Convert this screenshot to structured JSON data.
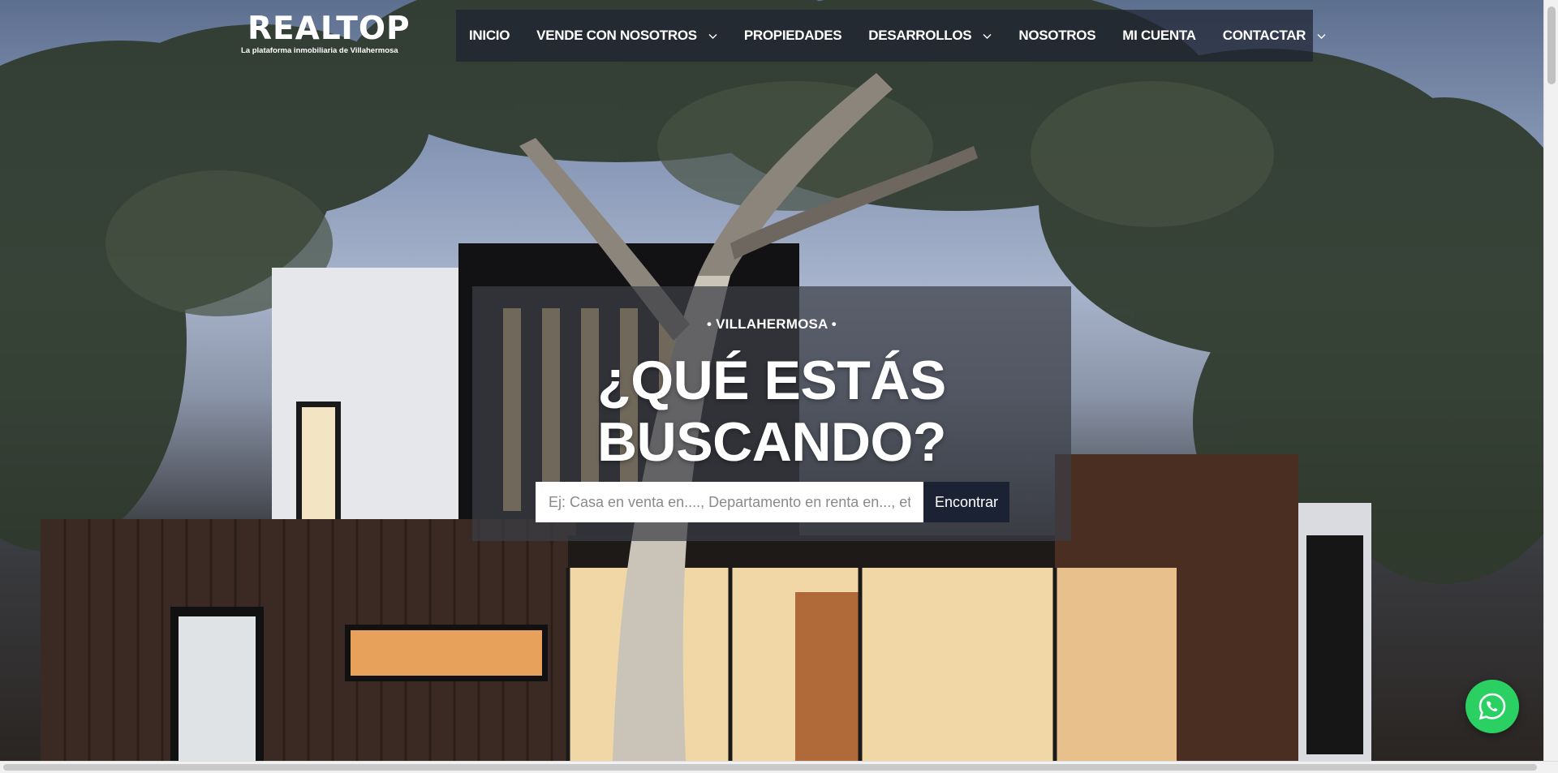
{
  "brand": {
    "logo_text": "REALTOP",
    "tagline": "La plataforma inmobiliaria de Villahermosa"
  },
  "nav": {
    "items": [
      {
        "label": "INICIO",
        "has_dropdown": false
      },
      {
        "label": "VENDE CON NOSOTROS",
        "has_dropdown": true
      },
      {
        "label": "PROPIEDADES",
        "has_dropdown": false
      },
      {
        "label": "DESARROLLOS",
        "has_dropdown": true
      },
      {
        "label": "NOSOTROS",
        "has_dropdown": false
      },
      {
        "label": "MI CUENTA",
        "has_dropdown": false
      },
      {
        "label": "CONTACTAR",
        "has_dropdown": true
      }
    ]
  },
  "hero": {
    "kicker": "• VILLAHERMOSA •",
    "headline": "¿QUÉ ESTÁS BUSCANDO?"
  },
  "search": {
    "placeholder": "Ej: Casa en venta en...., Departamento en renta en..., etc",
    "value": "",
    "button_label": "Encontrar"
  },
  "floating": {
    "whatsapp_icon": "whatsapp-icon"
  },
  "colors": {
    "nav_bg": "#1e2330",
    "button_bg": "#1a2233",
    "whatsapp": "#2bd063"
  }
}
